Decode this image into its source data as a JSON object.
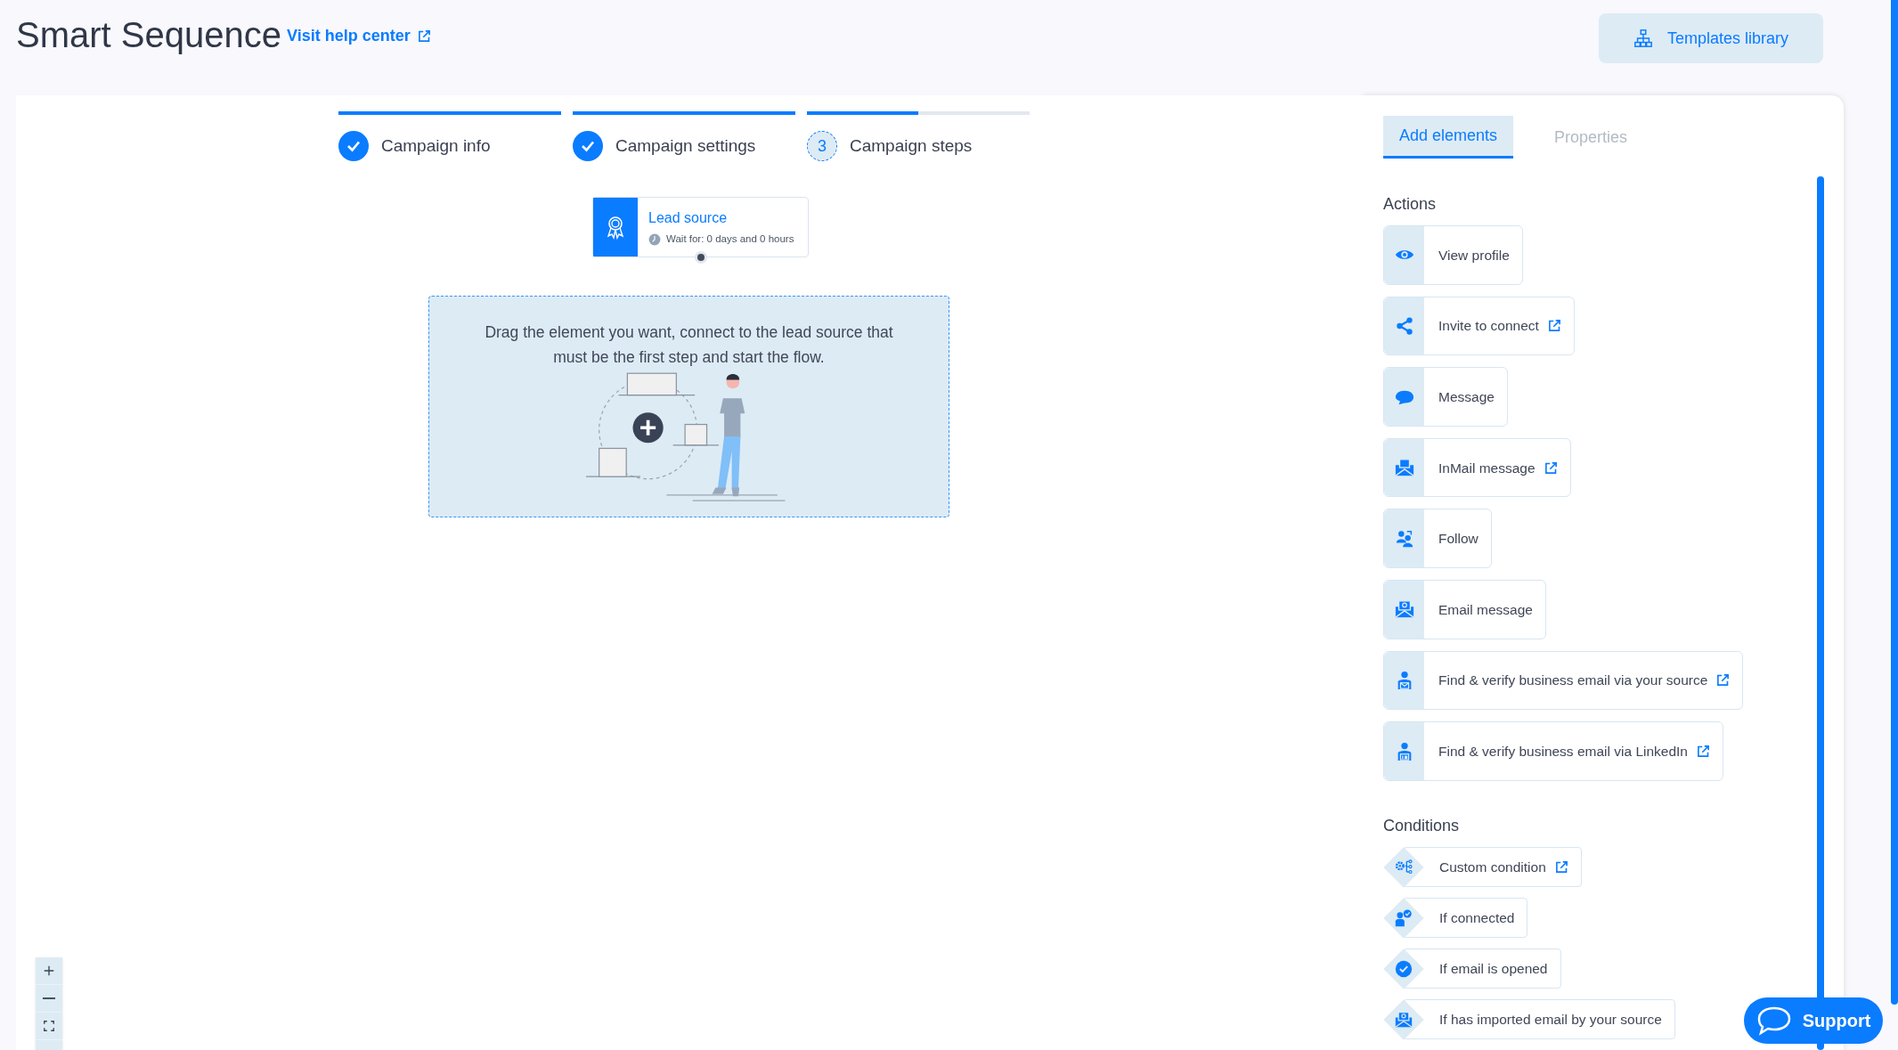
{
  "header": {
    "title": "Smart Sequence",
    "help_link": "Visit help center",
    "templates_button": "Templates library"
  },
  "stepper": [
    {
      "label": "Campaign info",
      "done": true,
      "level": 1
    },
    {
      "label": "Campaign settings",
      "done": true,
      "level": 1
    },
    {
      "label": "Campaign steps",
      "done": false,
      "number": "3",
      "level": 0.5
    }
  ],
  "lead_source": {
    "title": "Lead source",
    "wait": "Wait for: 0 days and 0 hours"
  },
  "drop_zone": {
    "text": "Drag the element you want, connect to the lead source that must be the first step and start the flow."
  },
  "panel": {
    "tabs": [
      {
        "label": "Add elements",
        "selected": true
      },
      {
        "label": "Properties",
        "selected": false
      }
    ],
    "sections": [
      {
        "heading": "Actions",
        "kind": "action",
        "items": [
          {
            "label": "View profile",
            "external": false
          },
          {
            "label": "Invite to connect",
            "external": true
          },
          {
            "label": "Message",
            "external": false
          },
          {
            "label": "InMail message",
            "external": true
          },
          {
            "label": "Follow",
            "external": false
          },
          {
            "label": "Email message",
            "external": false
          },
          {
            "label": "Find & verify business email via your source",
            "external": true
          },
          {
            "label": "Find & verify business email via LinkedIn",
            "external": true
          }
        ]
      },
      {
        "heading": "Conditions",
        "kind": "condition",
        "items": [
          {
            "label": "Custom condition",
            "external": true
          },
          {
            "label": "If connected",
            "external": false
          },
          {
            "label": "If email is opened",
            "external": false
          },
          {
            "label": "If has imported email by your source",
            "external": false
          }
        ]
      }
    ]
  },
  "support_button": "Support"
}
